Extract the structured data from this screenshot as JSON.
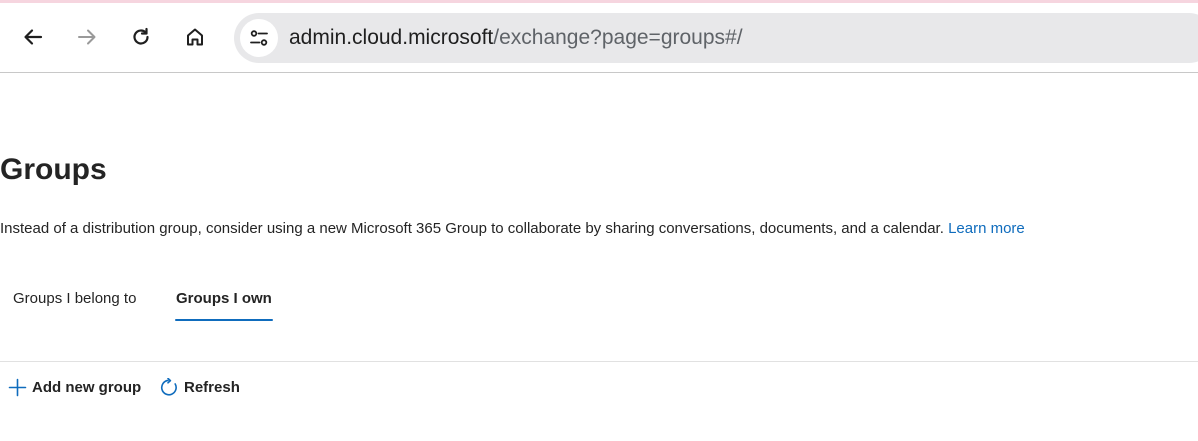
{
  "browser": {
    "url_host": "admin.cloud.microsoft",
    "url_path": "/exchange?page=groups#/"
  },
  "page": {
    "title": "Groups",
    "description": "Instead of a distribution group, consider using a new Microsoft 365 Group to collaborate by sharing conversations, documents, and a calendar.",
    "learn_more": "Learn more"
  },
  "tabs": [
    {
      "label": "Groups I belong to",
      "active": false
    },
    {
      "label": "Groups I own",
      "active": true
    }
  ],
  "commands": {
    "add_new_group": "Add new group",
    "refresh": "Refresh"
  },
  "colors": {
    "accent": "#0f6cbd",
    "omnibox_bg": "#e8e8ea",
    "top_strip": "#f6d5df"
  },
  "icons": [
    "back-arrow-icon",
    "forward-arrow-icon",
    "reload-icon",
    "home-icon",
    "site-settings-icon",
    "plus-icon",
    "refresh-icon"
  ]
}
